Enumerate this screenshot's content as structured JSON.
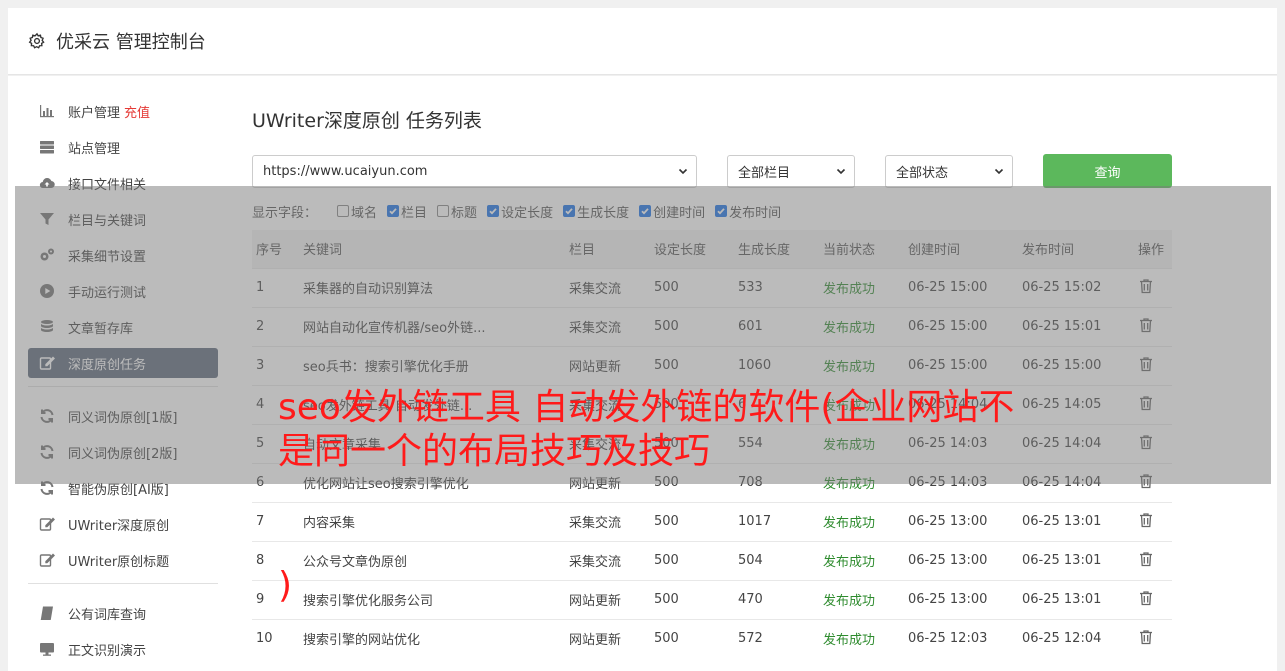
{
  "header": {
    "title": "优采云 管理控制台"
  },
  "sidebar": {
    "items": [
      {
        "label": "账户管理",
        "badge": "充值",
        "icon": "bar-chart-icon"
      },
      {
        "label": "站点管理",
        "icon": "server-icon"
      },
      {
        "label": "接口文件相关",
        "icon": "cloud-upload-icon"
      },
      {
        "label": "栏目与关键词",
        "icon": "filter-icon"
      },
      {
        "label": "采集细节设置",
        "icon": "gears-icon"
      },
      {
        "label": "手动运行测试",
        "icon": "play-circle-icon"
      },
      {
        "label": "文章暂存库",
        "icon": "database-icon"
      },
      {
        "label": "深度原创任务",
        "icon": "edit-icon"
      },
      {
        "label": "同义词伪原创[1版]",
        "icon": "refresh-icon"
      },
      {
        "label": "同义词伪原创[2版]",
        "icon": "refresh-icon"
      },
      {
        "label": "智能伪原创[AI版]",
        "icon": "refresh-icon"
      },
      {
        "label": "UWriter深度原创",
        "icon": "edit-icon"
      },
      {
        "label": "UWriter原创标题",
        "icon": "edit-icon"
      },
      {
        "label": "公有词库查询",
        "icon": "book-icon"
      },
      {
        "label": "正文识别演示",
        "icon": "monitor-icon"
      }
    ]
  },
  "main": {
    "title": "UWriter深度原创 任务列表",
    "filters": {
      "site": "https://www.ucaiyun.com",
      "category": "全部栏目",
      "status": "全部状态",
      "query_label": "查询"
    },
    "fields_label": "显示字段：",
    "fields": [
      {
        "label": "域名",
        "checked": false
      },
      {
        "label": "栏目",
        "checked": true
      },
      {
        "label": "标题",
        "checked": false
      },
      {
        "label": "设定长度",
        "checked": true
      },
      {
        "label": "生成长度",
        "checked": true
      },
      {
        "label": "创建时间",
        "checked": true
      },
      {
        "label": "发布时间",
        "checked": true
      }
    ],
    "table": {
      "headers": [
        "序号",
        "关键词",
        "栏目",
        "设定长度",
        "生成长度",
        "当前状态",
        "创建时间",
        "发布时间",
        "操作"
      ],
      "rows": [
        [
          "1",
          "采集器的自动识别算法",
          "采集交流",
          "500",
          "533",
          "发布成功",
          "06-25 15:00",
          "06-25 15:02"
        ],
        [
          "2",
          "网站自动化宣传机器/seo外链...",
          "采集交流",
          "500",
          "601",
          "发布成功",
          "06-25 15:00",
          "06-25 15:01"
        ],
        [
          "3",
          "seo兵书：搜索引擎优化手册",
          "网站更新",
          "500",
          "1060",
          "发布成功",
          "06-25 15:00",
          "06-25 15:00"
        ],
        [
          "4",
          "seo发外链工具 自动发外链...",
          "采集交流",
          "500",
          "6",
          "发布成功",
          "06-25 14:04",
          "06-25 14:05"
        ],
        [
          "5",
          "自动文章采集",
          "采集交流",
          "500",
          "554",
          "发布成功",
          "06-25 14:03",
          "06-25 14:04"
        ],
        [
          "6",
          "优化网站让seo搜索引擎优化",
          "网站更新",
          "500",
          "708",
          "发布成功",
          "06-25 14:03",
          "06-25 14:04"
        ],
        [
          "7",
          "内容采集",
          "采集交流",
          "500",
          "1017",
          "发布成功",
          "06-25 13:00",
          "06-25 13:01"
        ],
        [
          "8",
          "公众号文章伪原创",
          "采集交流",
          "500",
          "504",
          "发布成功",
          "06-25 13:00",
          "06-25 13:01"
        ],
        [
          "9",
          "搜索引擎优化服务公司",
          "网站更新",
          "500",
          "470",
          "发布成功",
          "06-25 13:00",
          "06-25 13:01"
        ],
        [
          "10",
          "搜索引擎的网站优化",
          "网站更新",
          "500",
          "572",
          "发布成功",
          "06-25 12:03",
          "06-25 12:04"
        ]
      ]
    }
  },
  "overlay": {
    "headline": "seo发外链工具 自动发外链的软件(企业网站不是同一个的布局技巧及技巧",
    "headline_tail": ")"
  }
}
